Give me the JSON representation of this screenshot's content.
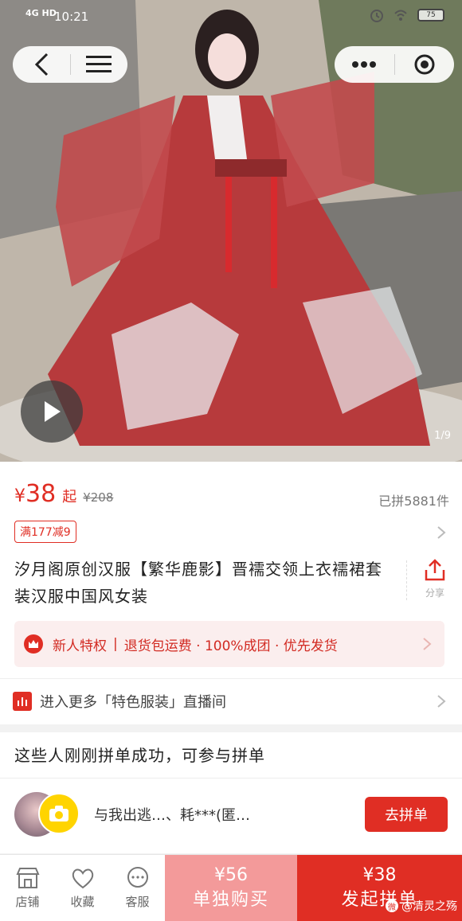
{
  "status": {
    "network": "4G HD",
    "time": "10:21",
    "battery": "75"
  },
  "gallery": {
    "counter": "1/9"
  },
  "price": {
    "currency": "¥",
    "amount": "38",
    "suffix": "起",
    "original": "¥208",
    "sold": "已拼5881件"
  },
  "coupon": {
    "label": "满177减9"
  },
  "product": {
    "title": "汐月阁原创汉服【繁华鹿影】晋襦交领上衣襦裙套装汉服中国风女装"
  },
  "share": {
    "label": "分享"
  },
  "perks": {
    "items": [
      "新人特权",
      "退货包运费 · 100%成团 · 优先发货"
    ],
    "separator": "|"
  },
  "live": {
    "text": "进入更多「特色服装」直播间"
  },
  "group": {
    "title": "这些人刚刚拼单成功，可参与拼单",
    "members_text": "与我出逃…、耗***(匿…",
    "join_label": "去拼单"
  },
  "bottom": {
    "tabs": [
      {
        "label": "店铺",
        "icon": "store-icon"
      },
      {
        "label": "收藏",
        "icon": "heart-icon"
      },
      {
        "label": "客服",
        "icon": "chat-icon"
      }
    ],
    "single": {
      "price": "¥56",
      "label": "单独购买"
    },
    "group_buy": {
      "price": "¥38",
      "label": "发起拼单"
    }
  },
  "watermark": {
    "text": "@清灵之殇"
  },
  "colors": {
    "accent": "#e02e24",
    "light_accent": "#f39a9a",
    "perk_bg": "#fbeeee"
  }
}
